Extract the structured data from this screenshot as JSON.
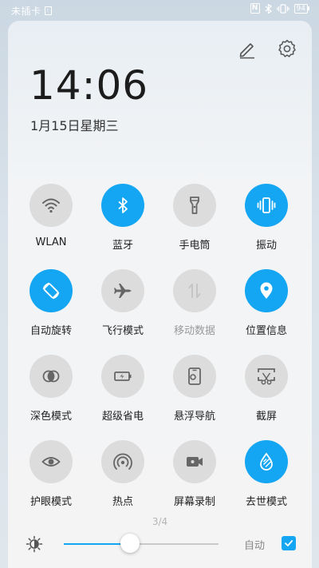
{
  "status": {
    "carrier": "未插卡",
    "sim_icon": "sim-absent-icon",
    "nfc": "N",
    "battery": "94"
  },
  "clock": {
    "time": "14:06",
    "date": "1月15日星期三"
  },
  "toggles": [
    {
      "label": "WLAN",
      "icon": "wifi-icon",
      "state": "off"
    },
    {
      "label": "蓝牙",
      "icon": "bluetooth-icon",
      "state": "on"
    },
    {
      "label": "手电筒",
      "icon": "flashlight-icon",
      "state": "off"
    },
    {
      "label": "振动",
      "icon": "vibrate-icon",
      "state": "on"
    },
    {
      "label": "自动旋转",
      "icon": "rotate-icon",
      "state": "on"
    },
    {
      "label": "飞行模式",
      "icon": "airplane-icon",
      "state": "off"
    },
    {
      "label": "移动数据",
      "icon": "mobile-data-icon",
      "state": "disabled"
    },
    {
      "label": "位置信息",
      "icon": "location-icon",
      "state": "on"
    },
    {
      "label": "深色模式",
      "icon": "dark-mode-icon",
      "state": "off"
    },
    {
      "label": "超级省电",
      "icon": "battery-saver-icon",
      "state": "off"
    },
    {
      "label": "悬浮导航",
      "icon": "floating-nav-icon",
      "state": "off"
    },
    {
      "label": "截屏",
      "icon": "screenshot-icon",
      "state": "off"
    },
    {
      "label": "护眼模式",
      "icon": "eye-icon",
      "state": "off"
    },
    {
      "label": "热点",
      "icon": "hotspot-icon",
      "state": "off"
    },
    {
      "label": "屏幕录制",
      "icon": "screen-record-icon",
      "state": "off"
    },
    {
      "label": "去世模式",
      "icon": "water-drop-icon",
      "state": "on"
    }
  ],
  "pager": "3/4",
  "brightness": {
    "level": 0.43,
    "auto_label": "自动",
    "auto_checked": true
  },
  "colors": {
    "accent": "#14a6f2",
    "tile_off": "#dcdcdc"
  }
}
